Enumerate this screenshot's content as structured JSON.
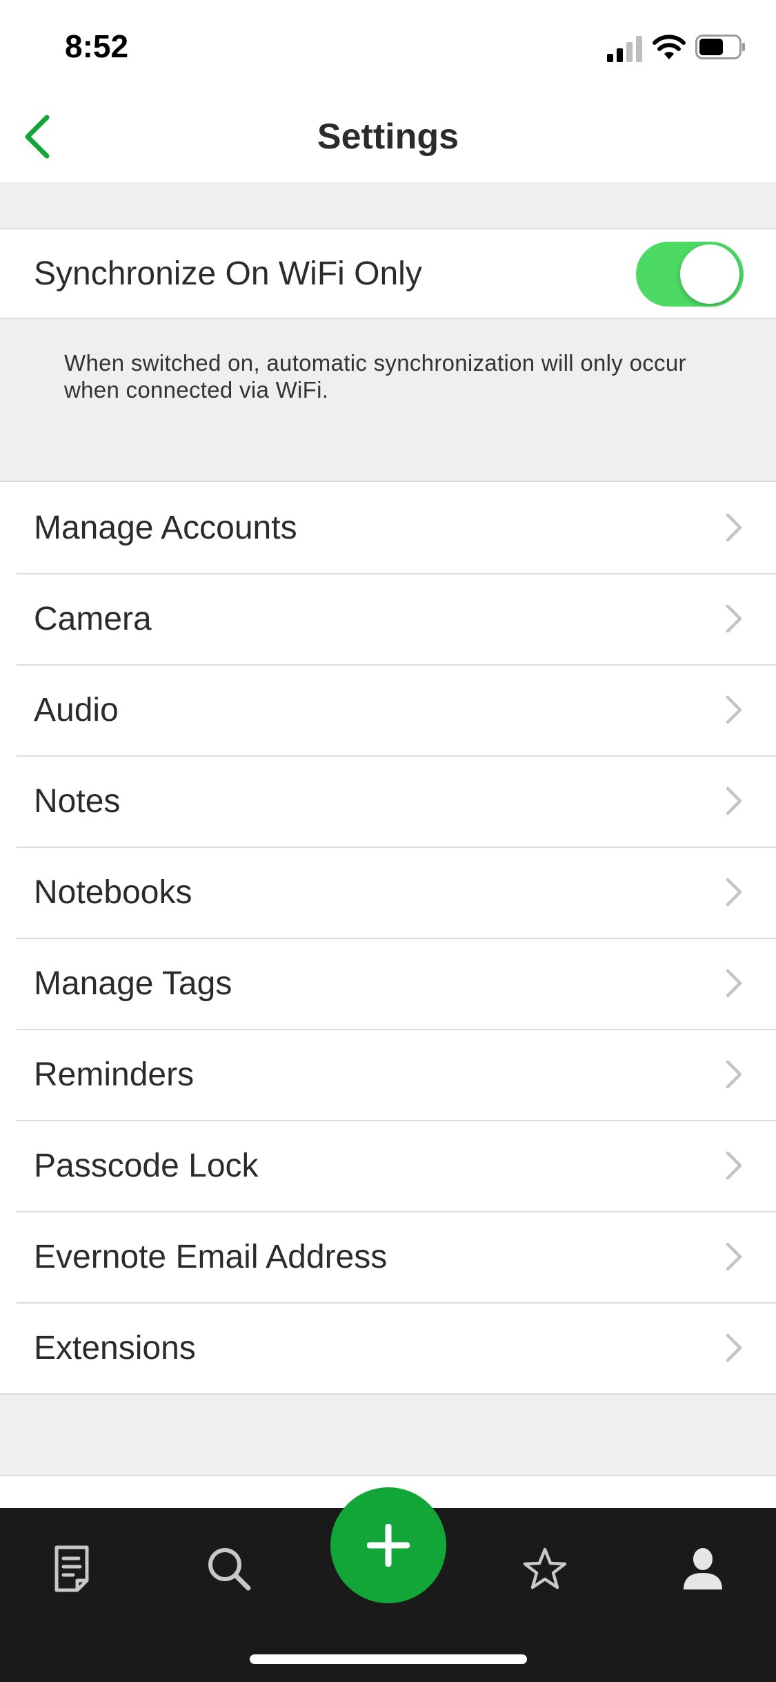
{
  "status_bar": {
    "time": "8:52",
    "icons": [
      "signal-icon",
      "wifi-icon",
      "battery-icon"
    ]
  },
  "nav": {
    "title": "Settings",
    "back_icon": "chevron-left-icon"
  },
  "sync": {
    "label": "Synchronize On WiFi Only",
    "enabled": true,
    "description": "When switched on, automatic synchronization will only occur when connected via WiFi."
  },
  "settings": {
    "items": [
      {
        "label": "Manage Accounts"
      },
      {
        "label": "Camera"
      },
      {
        "label": "Audio"
      },
      {
        "label": "Notes"
      },
      {
        "label": "Notebooks"
      },
      {
        "label": "Manage Tags"
      },
      {
        "label": "Reminders"
      },
      {
        "label": "Passcode Lock"
      },
      {
        "label": "Evernote Email Address"
      },
      {
        "label": "Extensions"
      }
    ]
  },
  "tab_bar": {
    "tabs": [
      "notes-icon",
      "search-icon",
      "add-note-icon",
      "shortcuts-star-icon",
      "account-icon"
    ]
  },
  "colors": {
    "accent": "#12a538",
    "toggle_on": "#4cd964",
    "background": "#efefef",
    "tab_bar": "#1a1a1a"
  }
}
